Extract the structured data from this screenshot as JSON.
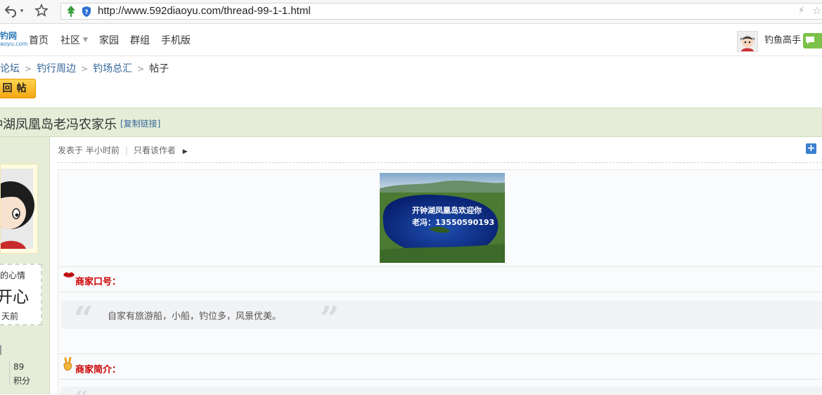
{
  "browser": {
    "url": "http://www.592diaoyu.com/thread-99-1-1.html",
    "icons": [
      "back-arrow-icon",
      "dropdown-icon",
      "star-icon",
      "shield-icon"
    ]
  },
  "site_nav": {
    "logo_text": "钓网",
    "logo_sub": "aoyu.com",
    "items": [
      "首页",
      "社区",
      "家园",
      "群组",
      "手机版"
    ],
    "username": "钓鱼高手"
  },
  "breadcrumb": [
    "论坛",
    "钓行周边",
    "钓场总汇",
    "帖子"
  ],
  "reply_button": "回帖",
  "thread": {
    "title": "钟湖凤凰岛老冯农家乐",
    "copy_link": "[复制链接]"
  },
  "author_panel": {
    "mood_label": "的心情",
    "mood_value": "开心",
    "mood_time": "天前",
    "stat_value": "89",
    "stat_label": "积分"
  },
  "post": {
    "meta_posted": "发表于 半小时前",
    "meta_author_only": "只看该作者",
    "banner_line1": "开钟湖凤凰岛欢迎你",
    "banner_line2": "老冯：13550590193",
    "slogan_label": "商家口号：",
    "slogan_text": "自家有旅游船，小船，钓位多，风景优美。",
    "intro_label": "商家简介："
  }
}
